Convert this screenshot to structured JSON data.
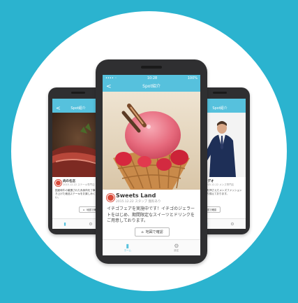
{
  "colors": {
    "background": "#2bb3cf",
    "accent": "#56c1dd",
    "logo": "#d94a3a"
  },
  "left_phone": {
    "nav_back": "<",
    "nav_title": "Spot紹介",
    "card": {
      "name": "肉の名店",
      "sub": "2015.12.22 ステーキ専門店",
      "desc": "国産和牛の厳選された赤身肉を丁寧に焼き上げた絶品ステーキをお楽しみください。"
    },
    "map_label": "地図で確認",
    "icons": [
      "map-pin-icon",
      "home-tab-icon",
      "settings-tab-icon"
    ]
  },
  "center_phone": {
    "status": {
      "carrier": "•••• ◦",
      "time": "10:28",
      "battery": "100%"
    },
    "nav_back": "<",
    "nav_title": "Spot紹介",
    "card": {
      "name": "Sweets Land",
      "sub": "2015.12.22 スタンプ 無料あり",
      "desc": "イチゴフェアを実施中です！イチゴのジェラートをはじめ、期間限定なスイーツとドリンクをご用意しております。"
    },
    "map_label": "地図で確認",
    "tabs": [
      {
        "icon": "home-tab-icon",
        "label": "ホーム"
      },
      {
        "icon": "settings-tab-icon",
        "label": "設定"
      }
    ]
  },
  "right_phone": {
    "nav_title": "Spot紹介",
    "card": {
      "name": "ロデオ",
      "sub": "2015.12.22 メンズ専門店",
      "desc": "トレンドを押さえたメンズファッションを多数取り揃えております。"
    },
    "map_label": "地図で確認"
  }
}
